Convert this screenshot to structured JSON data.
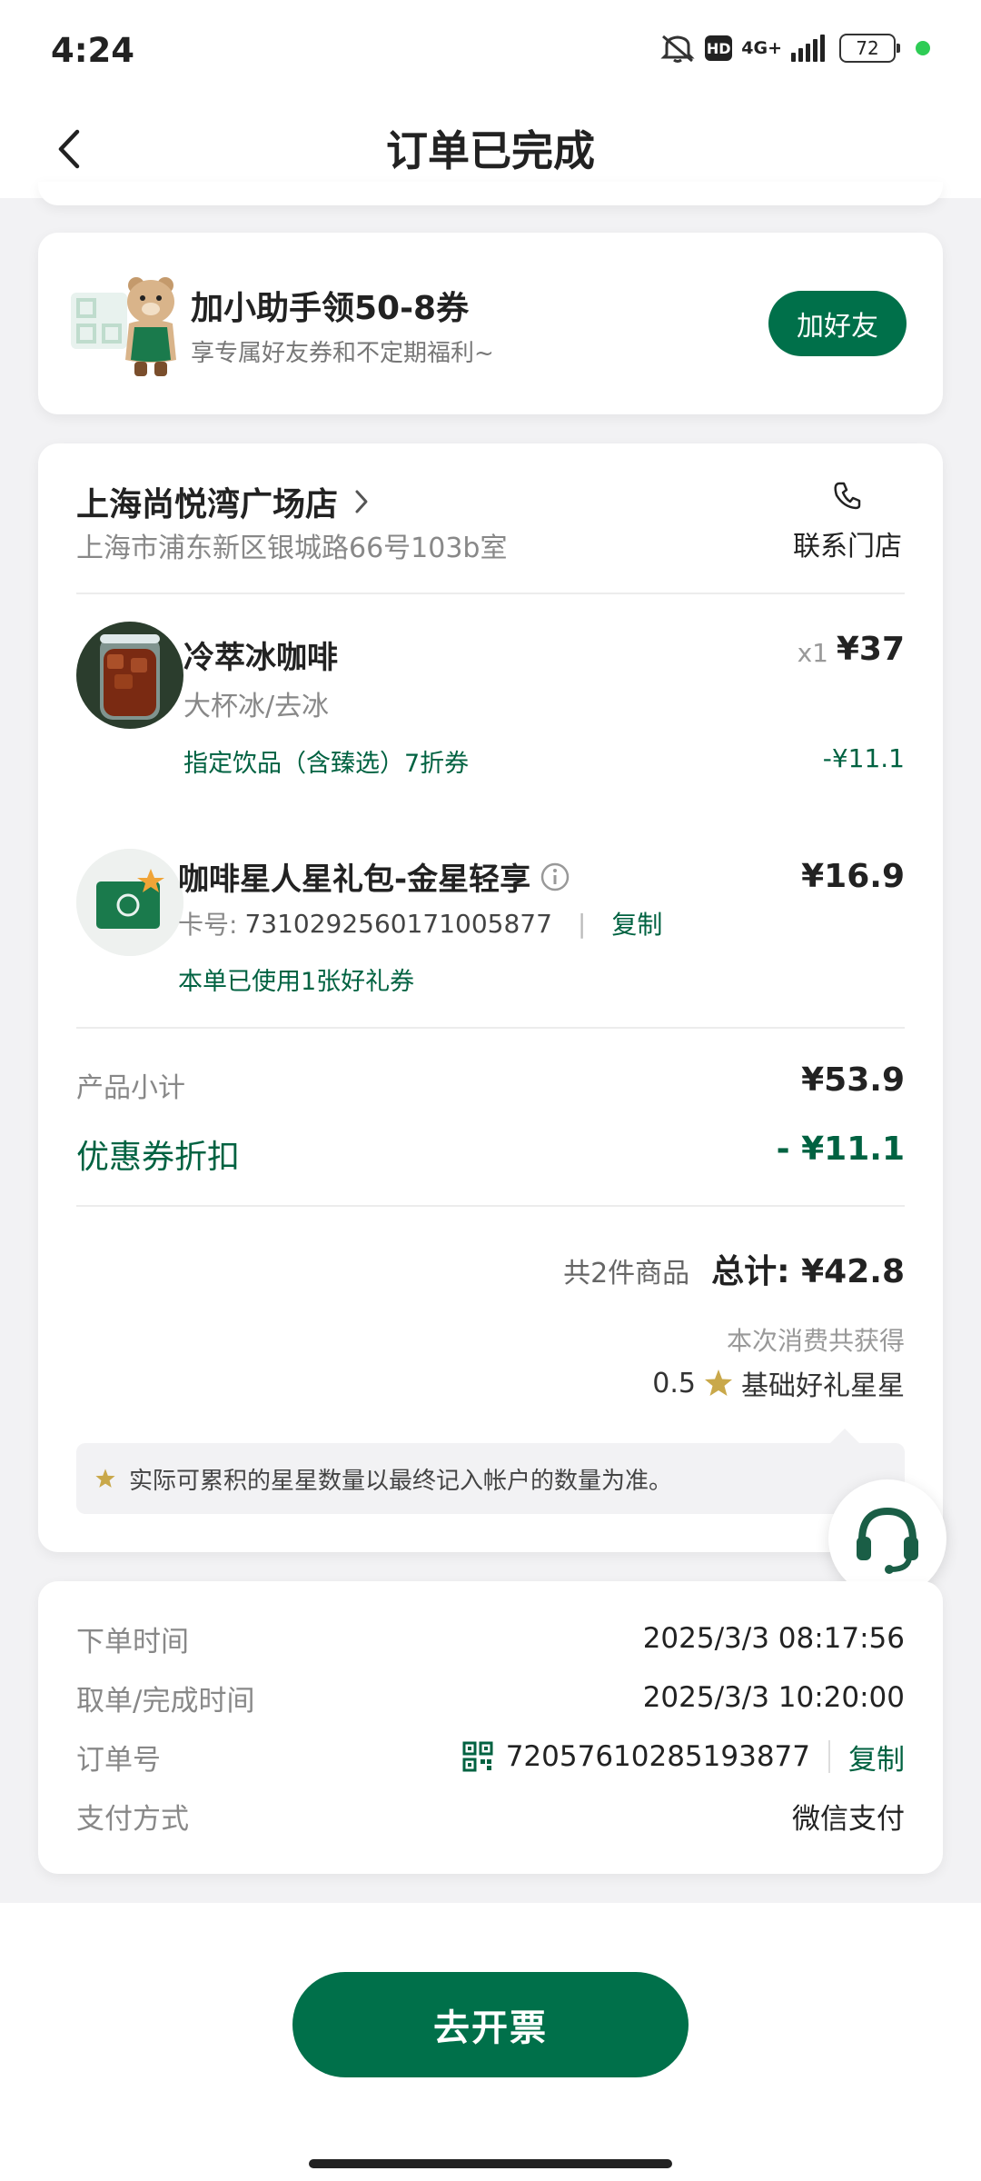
{
  "status_bar": {
    "time": "4:24",
    "network": "4G+",
    "hd": "HD",
    "battery": "72"
  },
  "header": {
    "title": "订单已完成"
  },
  "promo": {
    "title": "加小助手领50-8券",
    "subtitle": "享专属好友券和不定期福利~",
    "button_label": "加好友"
  },
  "store": {
    "name": "上海尚悦湾广场店",
    "address": "上海市浦东新区银城路66号103b室",
    "contact_label": "联系门店"
  },
  "items": [
    {
      "name": "冷萃冰咖啡",
      "spec": "大杯冰/去冰",
      "coupon": "指定饮品（含臻选）7折券",
      "qty": "x1",
      "price": "¥37",
      "discount": "-¥11.1"
    },
    {
      "name": "咖啡星人星礼包-金星轻享",
      "card_label": "卡号:",
      "card_number": "7310292560171005877",
      "copy_label": "复制",
      "coupon_note": "本单已使用1张好礼券",
      "price": "¥16.9"
    }
  ],
  "summary": {
    "subtotal_label": "产品小计",
    "subtotal_value": "¥53.9",
    "coupon_label": "优惠券折扣",
    "coupon_value": "- ¥11.1",
    "count_text": "共2件商品",
    "total_label": "总计:",
    "total_value": "¥42.8",
    "stars_title": "本次消费共获得",
    "stars_amount": "0.5",
    "stars_type": "基础好礼星星",
    "note": "实际可累积的星星数量以最终记入帐户的数量为准。"
  },
  "order_info": {
    "order_time_label": "下单时间",
    "order_time": "2025/3/3 08:17:56",
    "complete_time_label": "取单/完成时间",
    "complete_time": "2025/3/3 10:20:00",
    "order_no_label": "订单号",
    "order_no": "72057610285193877",
    "copy_label": "复制",
    "payment_label": "支付方式",
    "payment": "微信支付"
  },
  "invoice_button": "去开票",
  "colors": {
    "brand_green": "#00704a",
    "accent_green": "#006241",
    "star_gold": "#c9a84a"
  }
}
